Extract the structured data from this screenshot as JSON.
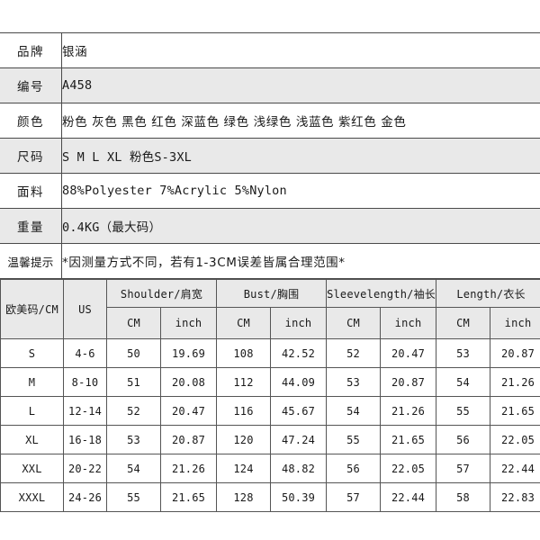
{
  "spec": {
    "rows": [
      {
        "label": "品牌",
        "value": "银涵",
        "cjk": true,
        "alt": false
      },
      {
        "label": "编号",
        "value": "A458",
        "cjk": false,
        "alt": true
      },
      {
        "label": "颜色",
        "value": "粉色 灰色 黑色 红色 深蓝色 绿色 浅绿色 浅蓝色 紫红色 金色",
        "cjk": true,
        "alt": false
      },
      {
        "label": "尺码",
        "value": "S M L XL  粉色S-3XL",
        "cjk": false,
        "alt": true
      },
      {
        "label": "面料",
        "value": "88%Polyester  7%Acrylic  5%Nylon",
        "cjk": false,
        "alt": false
      },
      {
        "label": "重量",
        "value": "0.4KG（最大码）",
        "cjk": false,
        "alt": true
      },
      {
        "label": "温馨提示",
        "value": "*因测量方式不同，若有1-3CM误差皆属合理范围*",
        "cjk": true,
        "alt": false
      }
    ]
  },
  "size_chart": {
    "header_main": [
      "欧美码/CM",
      "US",
      "Shoulder/肩宽",
      "Bust/胸围",
      "Sleevelength/袖长",
      "Length/衣长"
    ],
    "header_sub": [
      "",
      "",
      "CM",
      "inch",
      "CM",
      "inch",
      "CM",
      "inch",
      "CM",
      "inch"
    ],
    "rows": [
      {
        "size": "S",
        "us": "4-6",
        "shoulder_cm": "50",
        "shoulder_in": "19.69",
        "bust_cm": "108",
        "bust_in": "42.52",
        "sleeve_cm": "52",
        "sleeve_in": "20.47",
        "length_cm": "53",
        "length_in": "20.87"
      },
      {
        "size": "M",
        "us": "8-10",
        "shoulder_cm": "51",
        "shoulder_in": "20.08",
        "bust_cm": "112",
        "bust_in": "44.09",
        "sleeve_cm": "53",
        "sleeve_in": "20.87",
        "length_cm": "54",
        "length_in": "21.26"
      },
      {
        "size": "L",
        "us": "12-14",
        "shoulder_cm": "52",
        "shoulder_in": "20.47",
        "bust_cm": "116",
        "bust_in": "45.67",
        "sleeve_cm": "54",
        "sleeve_in": "21.26",
        "length_cm": "55",
        "length_in": "21.65"
      },
      {
        "size": "XL",
        "us": "16-18",
        "shoulder_cm": "53",
        "shoulder_in": "20.87",
        "bust_cm": "120",
        "bust_in": "47.24",
        "sleeve_cm": "55",
        "sleeve_in": "21.65",
        "length_cm": "56",
        "length_in": "22.05"
      },
      {
        "size": "XXL",
        "us": "20-22",
        "shoulder_cm": "54",
        "shoulder_in": "21.26",
        "bust_cm": "124",
        "bust_in": "48.82",
        "sleeve_cm": "56",
        "sleeve_in": "22.05",
        "length_cm": "57",
        "length_in": "22.44"
      },
      {
        "size": "XXXL",
        "us": "24-26",
        "shoulder_cm": "55",
        "shoulder_in": "21.65",
        "bust_cm": "128",
        "bust_in": "50.39",
        "sleeve_cm": "57",
        "sleeve_in": "22.44",
        "length_cm": "58",
        "length_in": "22.83"
      }
    ]
  },
  "colors": {
    "page_background": "#ffffff",
    "row_alt_background": "#e9e9e9",
    "border": "#4a4a4a",
    "text": "#1a1a1a"
  }
}
